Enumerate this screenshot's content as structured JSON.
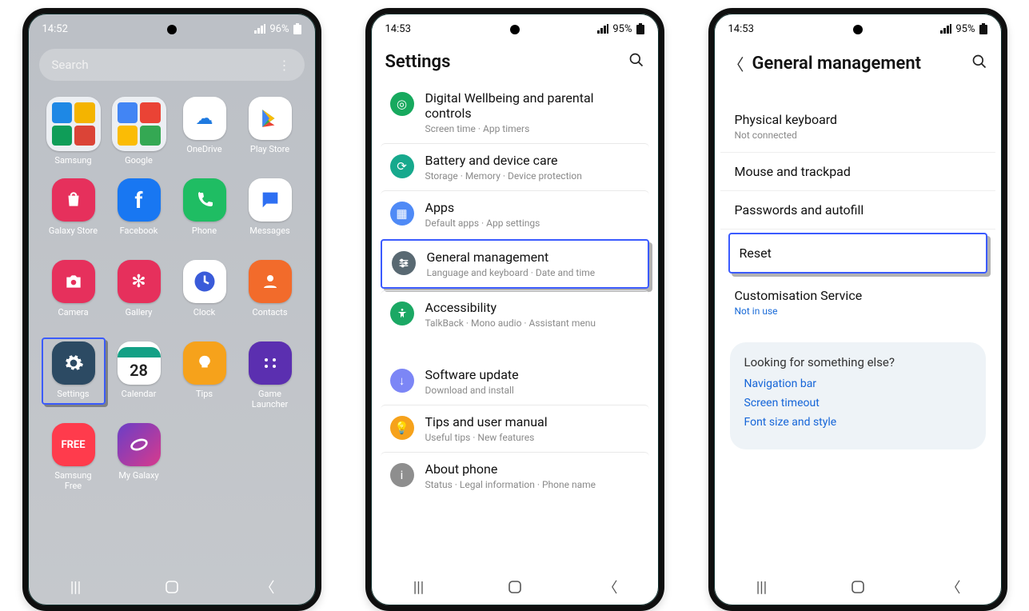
{
  "phone1": {
    "status": {
      "time": "14:52",
      "battery": "96%"
    },
    "search_placeholder": "Search",
    "apps": [
      {
        "label": "Samsung"
      },
      {
        "label": "Google"
      },
      {
        "label": "OneDrive"
      },
      {
        "label": "Play Store"
      },
      {
        "label": "Galaxy Store"
      },
      {
        "label": "Facebook"
      },
      {
        "label": "Phone"
      },
      {
        "label": "Messages"
      },
      {
        "label": "Camera"
      },
      {
        "label": "Gallery"
      },
      {
        "label": "Clock"
      },
      {
        "label": "Contacts"
      },
      {
        "label": "Settings",
        "highlight": true
      },
      {
        "label": "Calendar"
      },
      {
        "label": "Tips"
      },
      {
        "label": "Game Launcher"
      },
      {
        "label": "Samsung Free"
      },
      {
        "label": "My Galaxy"
      }
    ]
  },
  "phone2": {
    "status": {
      "time": "14:53",
      "battery": "95%"
    },
    "title": "Settings",
    "items": [
      {
        "title": "Digital Wellbeing and parental controls",
        "sub": "Screen time  ·  App timers",
        "color": "#17a95e"
      },
      {
        "title": "Battery and device care",
        "sub": "Storage  ·  Memory  ·  Device protection",
        "color": "#17a98d"
      },
      {
        "title": "Apps",
        "sub": "Default apps  ·  App settings",
        "color": "#4f8af6"
      },
      {
        "title": "General management",
        "sub": "Language and keyboard  ·  Date and time",
        "color": "#596972",
        "highlight": true
      },
      {
        "title": "Accessibility",
        "sub": "TalkBack  ·  Mono audio  ·  Assistant menu",
        "color": "#1ba864"
      },
      {
        "title": "Software update",
        "sub": "Download and install",
        "color": "#7c86f6"
      },
      {
        "title": "Tips and user manual",
        "sub": "Useful tips  ·  New features",
        "color": "#f6a21b"
      },
      {
        "title": "About phone",
        "sub": "Status  ·  Legal information  ·  Phone name",
        "color": "#8e8e8e"
      }
    ]
  },
  "phone3": {
    "status": {
      "time": "14:53",
      "battery": "95%"
    },
    "title": "General management",
    "items": [
      {
        "title": "Physical keyboard",
        "sub": "Not connected"
      },
      {
        "title": "Mouse and trackpad"
      },
      {
        "title": "Passwords and autofill"
      },
      {
        "title": "Reset",
        "highlight": true
      },
      {
        "title": "Customisation Service",
        "sub": "Not in use",
        "blue_sub": true
      }
    ],
    "suggest": {
      "heading": "Looking for something else?",
      "links": [
        "Navigation bar",
        "Screen timeout",
        "Font size and style"
      ]
    }
  }
}
